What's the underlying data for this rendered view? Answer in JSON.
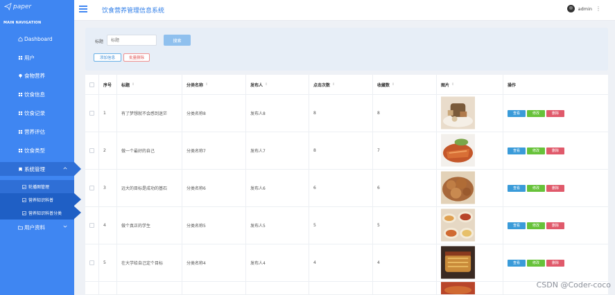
{
  "logo": {
    "text": "paper"
  },
  "nav_caption": "MAIN NAVIGATION",
  "sidebar": {
    "items": [
      {
        "label": "Dashboard",
        "icon": "home-icon"
      },
      {
        "label": "用户",
        "icon": "grid-icon"
      },
      {
        "label": "食物营养",
        "icon": "pin-icon"
      },
      {
        "label": "饮食信息",
        "icon": "grid-icon"
      },
      {
        "label": "饮食记录",
        "icon": "grid-icon"
      },
      {
        "label": "营养评估",
        "icon": "grid-icon"
      },
      {
        "label": "饮食类型",
        "icon": "grid-icon"
      },
      {
        "label": "系统管理",
        "icon": "bookmark-icon",
        "expanded": true
      },
      {
        "label": "用户资料",
        "icon": "folder-icon"
      }
    ],
    "sub_items": [
      {
        "label": "轮播图管理"
      },
      {
        "label": "营养知识科普",
        "active": true
      },
      {
        "label": "营养知识科普分类",
        "active": true
      }
    ]
  },
  "header": {
    "title": "饮食营养管理信息系统",
    "user": "admin"
  },
  "search": {
    "label": "标题",
    "placeholder": "标题",
    "search_button": "搜索",
    "add_button": "添加信息",
    "batch_delete_button": "批量删除"
  },
  "table": {
    "columns": [
      "",
      "序号",
      "标题",
      "分类名称",
      "发布人",
      "点击次数",
      "收藏数",
      "图片",
      "操作"
    ],
    "rows": [
      {
        "idx": "1",
        "title": "有了梦想就不会感到迷茫",
        "category": "分类名称8",
        "publisher": "发布人8",
        "clicks": "8",
        "favs": "8",
        "image": "teapot-plate"
      },
      {
        "idx": "2",
        "title": "做一个最好的自己",
        "category": "分类名称7",
        "publisher": "发布人7",
        "clicks": "8",
        "favs": "7",
        "image": "roast-duck"
      },
      {
        "idx": "3",
        "title": "远大的目标是成功的基石",
        "category": "分类名称6",
        "publisher": "发布人6",
        "clicks": "6",
        "favs": "6",
        "image": "fried-snack"
      },
      {
        "idx": "4",
        "title": "做个真正的学生",
        "category": "分类名称5",
        "publisher": "发布人5",
        "clicks": "5",
        "favs": "5",
        "image": "bowls"
      },
      {
        "idx": "5",
        "title": "在大学给自己定个目标",
        "category": "分类名称4",
        "publisher": "发布人4",
        "clicks": "4",
        "favs": "4",
        "image": "pastry"
      }
    ],
    "actions": {
      "view": "查看",
      "edit": "修改",
      "delete": "删除"
    }
  },
  "watermark": "CSDN @Coder-coco",
  "colors": {
    "sidebar": "#3f86f2",
    "accent": "#2f7ee8",
    "view": "#3a9bd9",
    "edit": "#67c23a",
    "delete": "#e05a6b"
  }
}
